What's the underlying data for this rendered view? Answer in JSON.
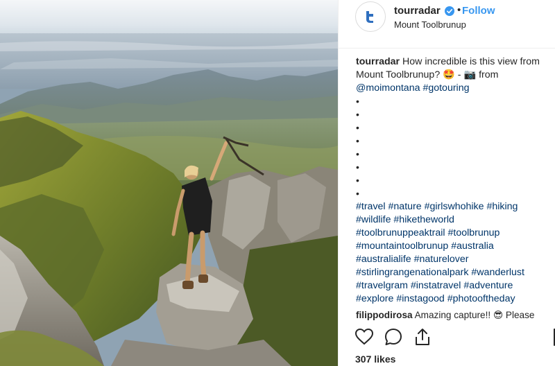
{
  "post": {
    "author": "tourradar",
    "follow_label": "Follow",
    "separator": "•",
    "location": "Mount Toolbrunup"
  },
  "caption": {
    "username": "tourradar",
    "text_line1": "How incredible is this view from",
    "text_line2_a": "Mount Toolbrunup?",
    "emoji_star": "🤩",
    "dash": "-",
    "emoji_camera": "📷",
    "from_word": "from",
    "mention": "@moimontana",
    "hashtag_first": "#gotouring",
    "bullet": "•",
    "hashtag_lines": [
      "#travel #nature #girlswhohike #hiking",
      "#wildlife #hiketheworld",
      "#toolbrunuppeaktrail #toolbrunup",
      "#mountaintoolbrunup #australia",
      "#australialife #naturelover",
      "#stirlingrangenationalpark #wanderlust",
      "#travelgram #instatravel #adventure",
      "#explore #instagood #photooftheday"
    ]
  },
  "comment": {
    "username": "filippodirosa",
    "text": "Amazing capture!!",
    "emoji": "😎",
    "text_after": "Please"
  },
  "actions": {
    "like_icon": "heart-icon",
    "comment_icon": "comment-icon",
    "share_icon": "share-icon"
  },
  "likes": "307 likes",
  "colors": {
    "link_blue": "#3897f0",
    "hashtag": "#003569",
    "text": "#262626",
    "divider": "#efefef"
  }
}
